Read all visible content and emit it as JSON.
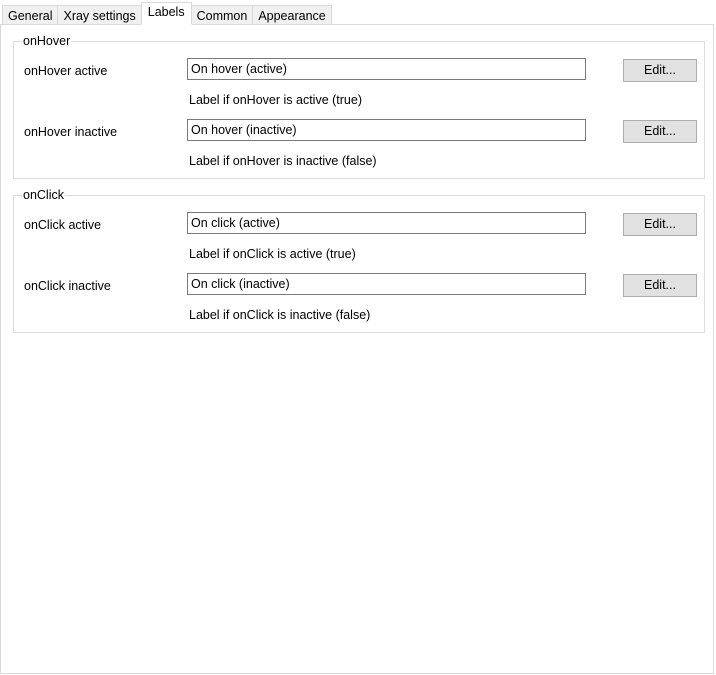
{
  "tabs": [
    {
      "label": "General",
      "active": false
    },
    {
      "label": "Xray settings",
      "active": false
    },
    {
      "label": "Labels",
      "active": true
    },
    {
      "label": "Common",
      "active": false
    },
    {
      "label": "Appearance",
      "active": false
    }
  ],
  "groups": {
    "onHover": {
      "title": "onHover",
      "active": {
        "label": "onHover active",
        "value": "On hover (active)",
        "hint": "Label if onHover is active (true)",
        "edit_label": "Edit..."
      },
      "inactive": {
        "label": "onHover inactive",
        "value": "On hover (inactive)",
        "hint": "Label if onHover is inactive (false)",
        "edit_label": "Edit..."
      }
    },
    "onClick": {
      "title": "onClick",
      "active": {
        "label": "onClick active",
        "value": "On click (active)",
        "hint": "Label if onClick is active (true)",
        "edit_label": "Edit..."
      },
      "inactive": {
        "label": "onClick inactive",
        "value": "On click (inactive)",
        "hint": "Label if onClick is inactive (false)",
        "edit_label": "Edit..."
      }
    }
  }
}
